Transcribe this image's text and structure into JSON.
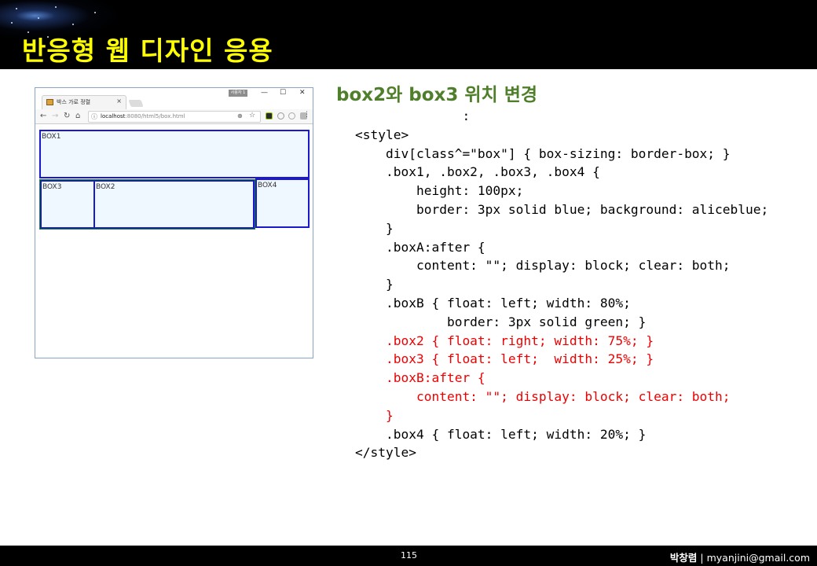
{
  "header": {
    "title": "반응형 웹 디자인 응용"
  },
  "browser": {
    "tab_title": "박스 가로 정렬",
    "tab_close": "×",
    "user_badge": "사용자 1",
    "win_min": "—",
    "win_max": "☐",
    "win_close": "✕",
    "url_host": "localhost",
    "url_path": ":8080/html5/box.html",
    "boxes": {
      "box1": "BOX1",
      "box2": "BOX2",
      "box3": "BOX3",
      "box4": "BOX4"
    }
  },
  "section_title": "box2와 box3 위치 변경",
  "code_lines": [
    {
      "text": "              :",
      "red": false
    },
    {
      "text": "<style>",
      "red": false
    },
    {
      "text": "    div[class^=\"box\"] { box-sizing: border-box; }",
      "red": false
    },
    {
      "text": "    .box1, .box2, .box3, .box4 {",
      "red": false
    },
    {
      "text": "        height: 100px;",
      "red": false
    },
    {
      "text": "        border: 3px solid blue; background: aliceblue;",
      "red": false
    },
    {
      "text": "    }",
      "red": false
    },
    {
      "text": "    .boxA:after {",
      "red": false
    },
    {
      "text": "        content: \"\"; display: block; clear: both;",
      "red": false
    },
    {
      "text": "    }",
      "red": false
    },
    {
      "text": "    .boxB { float: left; width: 80%;",
      "red": false
    },
    {
      "text": "            border: 3px solid green; }",
      "red": false
    },
    {
      "text": "    .box2 { float: right; width: 75%; }",
      "red": true
    },
    {
      "text": "    .box3 { float: left;  width: 25%; }",
      "red": true
    },
    {
      "text": "    .boxB:after {",
      "red": true
    },
    {
      "text": "        content: \"\"; display: block; clear: both;",
      "red": true
    },
    {
      "text": "    }",
      "red": true
    },
    {
      "text": "    .box4 { float: left; width: 20%; }",
      "red": false
    },
    {
      "text": "</style>",
      "red": false
    }
  ],
  "footer": {
    "page": "115",
    "author": "박창렴",
    "separator": " | ",
    "email": "myanjini@gmail.com"
  },
  "colors": {
    "header_title": "#ffff00",
    "section_title": "#4f7f2a",
    "code_red": "#ee0000",
    "box_border": "#1a1acc",
    "box_background": "#f0f8ff",
    "boxB_border": "#1c8a1c"
  }
}
